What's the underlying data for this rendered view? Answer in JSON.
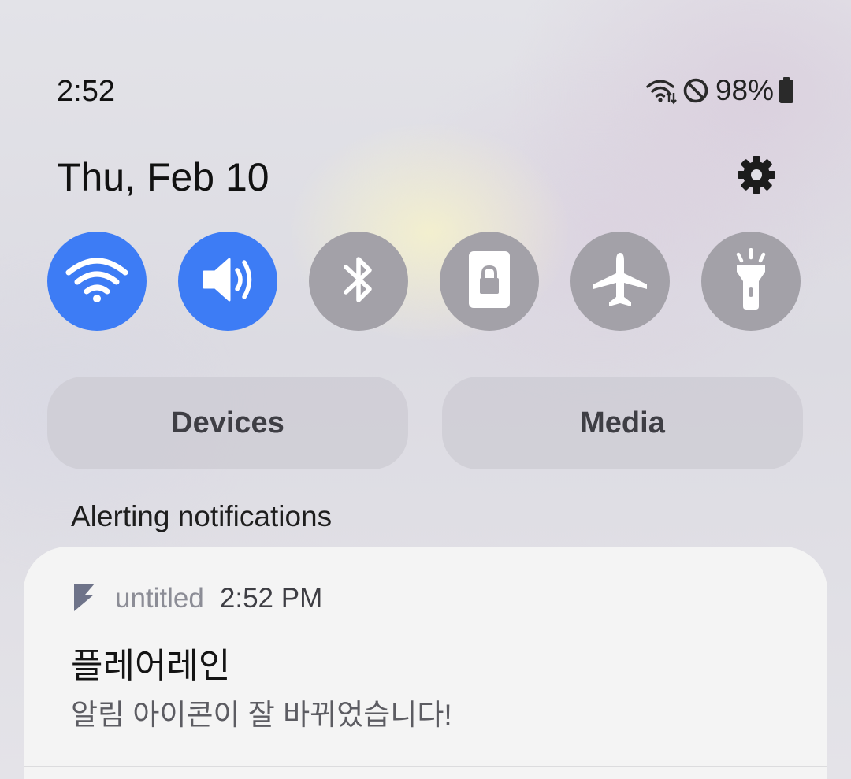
{
  "status_bar": {
    "time": "2:52",
    "battery_percent": "98%",
    "icons": [
      "wifi-data-icon",
      "do-not-disturb-icon",
      "battery-icon"
    ]
  },
  "header": {
    "date": "Thu, Feb 10",
    "settings_icon": "gear-icon"
  },
  "quick_settings": [
    {
      "name": "wifi",
      "icon": "wifi-icon",
      "state": "on"
    },
    {
      "name": "sound",
      "icon": "speaker-icon",
      "state": "on"
    },
    {
      "name": "bluetooth",
      "icon": "bluetooth-icon",
      "state": "off"
    },
    {
      "name": "portrait-lock",
      "icon": "portrait-lock-icon",
      "state": "off"
    },
    {
      "name": "airplane-mode",
      "icon": "airplane-icon",
      "state": "off"
    },
    {
      "name": "flashlight",
      "icon": "flashlight-icon",
      "state": "off"
    }
  ],
  "buttons": {
    "devices": "Devices",
    "media": "Media"
  },
  "section": {
    "label": "Alerting notifications"
  },
  "notification": {
    "app_icon": "flame-app-icon",
    "app_name": "untitled",
    "time": "2:52 PM",
    "title": "플레어레인",
    "body": "알림 아이콘이 잘 바뀌었습니다!"
  },
  "colors": {
    "tile_on": "#3d7cf5",
    "tile_off": "#a3a1a8",
    "card": "#f4f4f4"
  }
}
